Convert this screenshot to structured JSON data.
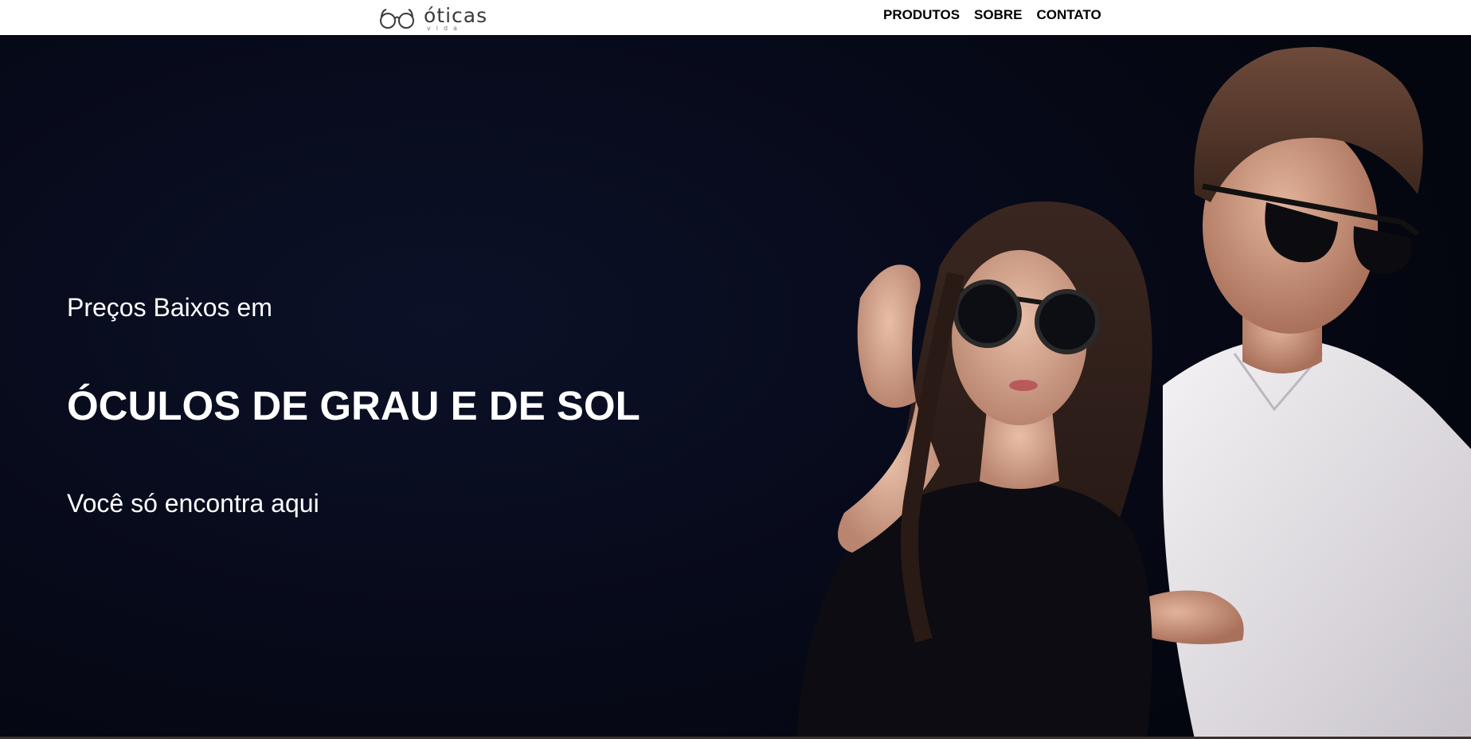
{
  "header": {
    "logo": {
      "word": "óticas",
      "sub": "vida"
    },
    "nav": [
      {
        "label": "PRODUTOS"
      },
      {
        "label": "SOBRE"
      },
      {
        "label": "CONTATO"
      }
    ]
  },
  "hero": {
    "line1": "Preços Baixos em",
    "headline": "ÓCULOS DE GRAU E DE SOL",
    "line3": "Você só encontra aqui",
    "photo_icon": "couple-with-sunglasses-photo"
  },
  "colors": {
    "hero_background": "#070a1a",
    "header_background": "#ffffff",
    "text_on_hero": "#ffffff",
    "nav_text": "#000000"
  }
}
